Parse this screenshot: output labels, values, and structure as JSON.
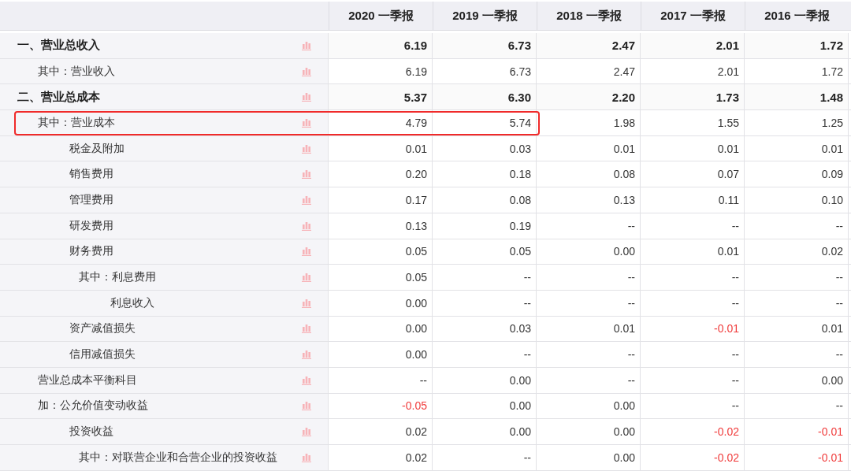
{
  "table": {
    "columns": [
      "2020 一季报",
      "2019 一季报",
      "2018 一季报",
      "2017 一季报",
      "2016 一季报"
    ],
    "rows": [
      {
        "label": "一、营业总收入",
        "kind": "total",
        "highlighted": false,
        "values": [
          "6.19",
          "6.73",
          "2.47",
          "2.01",
          "1.72"
        ],
        "negative": [
          false,
          false,
          false,
          false,
          false
        ],
        "children": [
          {
            "label": "其中：营业收入",
            "kind": "sub",
            "highlighted": false,
            "values": [
              "6.19",
              "6.73",
              "2.47",
              "2.01",
              "1.72"
            ],
            "negative": [
              false,
              false,
              false,
              false,
              false
            ]
          }
        ]
      },
      {
        "label": "二、营业总成本",
        "kind": "total",
        "highlighted": false,
        "values": [
          "5.37",
          "6.30",
          "2.20",
          "1.73",
          "1.48"
        ],
        "negative": [
          false,
          false,
          false,
          false,
          false
        ],
        "children": [
          {
            "label": "其中：营业成本",
            "kind": "sub",
            "highlighted": true,
            "values": [
              "4.79",
              "5.74",
              "1.98",
              "1.55",
              "1.25"
            ],
            "negative": [
              false,
              false,
              false,
              false,
              false
            ]
          },
          {
            "label": "税金及附加",
            "kind": "item",
            "highlighted": false,
            "values": [
              "0.01",
              "0.03",
              "0.01",
              "0.01",
              "0.01"
            ],
            "negative": [
              false,
              false,
              false,
              false,
              false
            ]
          },
          {
            "label": "销售费用",
            "kind": "item",
            "highlighted": false,
            "values": [
              "0.20",
              "0.18",
              "0.08",
              "0.07",
              "0.09"
            ],
            "negative": [
              false,
              false,
              false,
              false,
              false
            ]
          },
          {
            "label": "管理费用",
            "kind": "item",
            "highlighted": false,
            "values": [
              "0.17",
              "0.08",
              "0.13",
              "0.11",
              "0.10"
            ],
            "negative": [
              false,
              false,
              false,
              false,
              false
            ]
          },
          {
            "label": "研发费用",
            "kind": "item",
            "highlighted": false,
            "values": [
              "0.13",
              "0.19",
              "--",
              "--",
              "--"
            ],
            "negative": [
              false,
              false,
              false,
              false,
              false
            ]
          },
          {
            "label": "财务费用",
            "kind": "item",
            "highlighted": false,
            "values": [
              "0.05",
              "0.05",
              "0.00",
              "0.01",
              "0.02"
            ],
            "negative": [
              false,
              false,
              false,
              false,
              false
            ],
            "children": [
              {
                "label": "其中：利息费用",
                "kind": "sub",
                "highlighted": false,
                "values": [
                  "0.05",
                  "--",
                  "--",
                  "--",
                  "--"
                ],
                "negative": [
                  false,
                  false,
                  false,
                  false,
                  false
                ]
              },
              {
                "label": "利息收入",
                "kind": "item",
                "highlighted": false,
                "values": [
                  "0.00",
                  "--",
                  "--",
                  "--",
                  "--"
                ],
                "negative": [
                  false,
                  false,
                  false,
                  false,
                  false
                ]
              }
            ]
          },
          {
            "label": "资产减值损失",
            "kind": "item",
            "highlighted": false,
            "values": [
              "0.00",
              "0.03",
              "0.01",
              "-0.01",
              "0.01"
            ],
            "negative": [
              false,
              false,
              false,
              true,
              false
            ]
          },
          {
            "label": "信用减值损失",
            "kind": "item",
            "highlighted": false,
            "values": [
              "0.00",
              "--",
              "--",
              "--",
              "--"
            ],
            "negative": [
              false,
              false,
              false,
              false,
              false
            ]
          }
        ]
      },
      {
        "label": "营业总成本平衡科目",
        "kind": "item",
        "highlighted": false,
        "values": [
          "--",
          "0.00",
          "--",
          "--",
          "0.00"
        ],
        "negative": [
          false,
          false,
          false,
          false,
          false
        ]
      },
      {
        "label": "加：公允价值变动收益",
        "kind": "item",
        "highlighted": false,
        "values": [
          "-0.05",
          "0.00",
          "0.00",
          "--",
          "--"
        ],
        "negative": [
          true,
          false,
          false,
          false,
          false
        ],
        "children": [
          {
            "label": "投资收益",
            "kind": "item",
            "highlighted": false,
            "values": [
              "0.02",
              "0.00",
              "0.00",
              "-0.02",
              "-0.01"
            ],
            "negative": [
              false,
              false,
              false,
              true,
              true
            ],
            "children": [
              {
                "label": "其中：对联营企业和合营企业的投资收益",
                "kind": "sub",
                "highlighted": false,
                "values": [
                  "0.02",
                  "--",
                  "0.00",
                  "-0.02",
                  "-0.01"
                ],
                "negative": [
                  false,
                  false,
                  false,
                  true,
                  true
                ]
              }
            ]
          }
        ]
      }
    ]
  }
}
